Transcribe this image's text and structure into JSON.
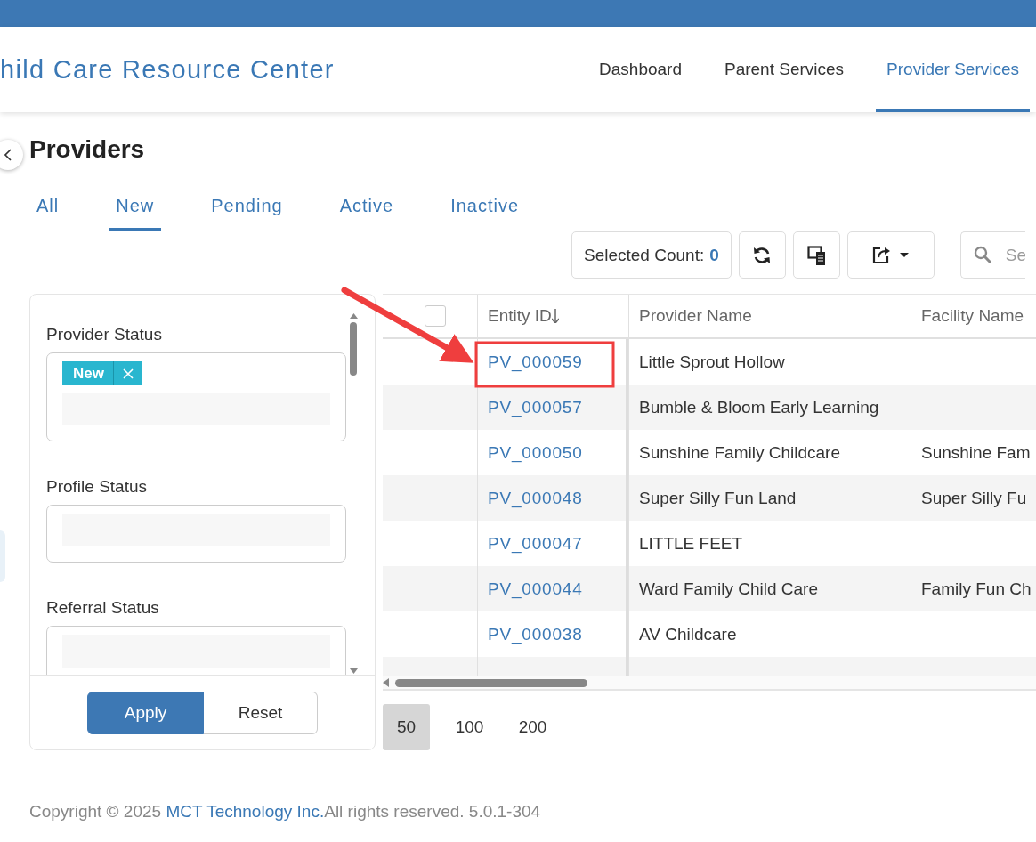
{
  "header": {
    "title": "hild Care Resource Center",
    "nav": [
      {
        "label": "Dashboard",
        "selected": false
      },
      {
        "label": "Parent Services",
        "selected": false
      },
      {
        "label": "Provider Services",
        "selected": true
      }
    ]
  },
  "page": {
    "title": "Providers"
  },
  "tabs": [
    {
      "label": "All",
      "selected": false
    },
    {
      "label": "New",
      "selected": true
    },
    {
      "label": "Pending",
      "selected": false
    },
    {
      "label": "Active",
      "selected": false
    },
    {
      "label": "Inactive",
      "selected": false
    }
  ],
  "toolbar": {
    "selected_count_label": "Selected Count:",
    "selected_count": "0",
    "search": {
      "placeholder": "Se"
    }
  },
  "filters": {
    "fields": [
      {
        "label": "Provider Status",
        "chips": [
          "New"
        ]
      },
      {
        "label": "Profile Status"
      },
      {
        "label": "Referral Status"
      }
    ],
    "buttons": [
      {
        "label": "Apply",
        "kind": "primary"
      },
      {
        "label": "Reset",
        "kind": "secondary"
      }
    ]
  },
  "table": {
    "select_all": {
      "checked": false
    },
    "columns": [
      {
        "label": "Entity ID",
        "sorted_descending": true
      },
      {
        "label": "Provider Name"
      },
      {
        "label": "Facility Name"
      }
    ],
    "rows": [
      {
        "entity_id": "PV_000059",
        "provider_name": "Little Sprout Hollow"
      },
      {
        "entity_id": "PV_000057",
        "provider_name": "Bumble & Bloom Early Learning"
      },
      {
        "entity_id": "PV_000050",
        "provider_name": "Sunshine Family Childcare",
        "facility_name": "Sunshine Fam"
      },
      {
        "entity_id": "PV_000048",
        "provider_name": "Super Silly Fun Land",
        "facility_name": "Super Silly Fu"
      },
      {
        "entity_id": "PV_000047",
        "provider_name": "LITTLE FEET"
      },
      {
        "entity_id": "PV_000044",
        "provider_name": "Ward Family Child Care",
        "facility_name": "Family Fun Ch"
      },
      {
        "entity_id": "PV_000038",
        "provider_name": "AV Childcare"
      }
    ]
  },
  "pagination": [
    {
      "label": "50",
      "selected": true
    },
    {
      "label": "100",
      "selected": false
    },
    {
      "label": "200",
      "selected": false
    }
  ],
  "footer": {
    "before": "Copyright © 2025 ",
    "link": "MCT Technology Inc.",
    "after": "All rights reserved. 5.0.1-304"
  }
}
